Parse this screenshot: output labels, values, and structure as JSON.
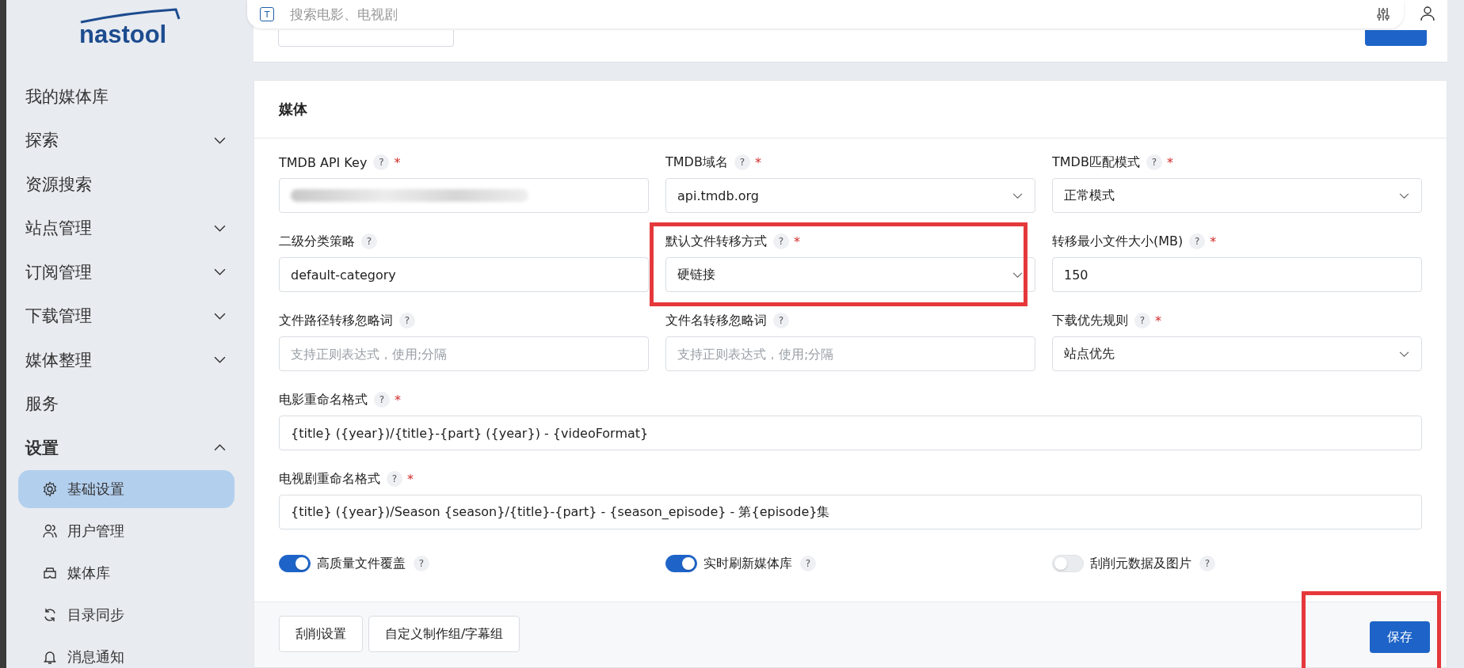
{
  "logo": {
    "text": "nastool"
  },
  "search": {
    "placeholder": "搜索电影、电视剧",
    "prefix": "T"
  },
  "sidebar": {
    "items": [
      {
        "label": "我的媒体库",
        "kind": "link"
      },
      {
        "label": "探索",
        "kind": "group",
        "expanded": false
      },
      {
        "label": "资源搜索",
        "kind": "link"
      },
      {
        "label": "站点管理",
        "kind": "group",
        "expanded": false
      },
      {
        "label": "订阅管理",
        "kind": "group",
        "expanded": false
      },
      {
        "label": "下载管理",
        "kind": "group",
        "expanded": false
      },
      {
        "label": "媒体整理",
        "kind": "group",
        "expanded": false
      },
      {
        "label": "服务",
        "kind": "link"
      },
      {
        "label": "设置",
        "kind": "group",
        "expanded": true,
        "children": [
          {
            "label": "基础设置",
            "selected": true
          },
          {
            "label": "用户管理",
            "selected": false
          },
          {
            "label": "媒体库",
            "selected": false
          },
          {
            "label": "目录同步",
            "selected": false
          },
          {
            "label": "消息通知",
            "selected": false
          }
        ]
      }
    ]
  },
  "section": {
    "title": "媒体",
    "rows": [
      [
        {
          "label": "TMDB API Key",
          "help": "?",
          "required_mark": "*",
          "kind": "redacted",
          "highlighted": false
        },
        {
          "label": "TMDB域名",
          "help": "?",
          "required_mark": "*",
          "kind": "select",
          "value": "api.tmdb.org",
          "highlighted": false
        },
        {
          "label": "TMDB匹配模式",
          "help": "?",
          "required_mark": "*",
          "kind": "select",
          "value": "正常模式",
          "highlighted": false
        }
      ],
      [
        {
          "label": "二级分类策略",
          "help": "?",
          "kind": "input",
          "value": "default-category",
          "highlighted": false
        },
        {
          "label": "默认文件转移方式",
          "help": "?",
          "required_mark": "*",
          "kind": "select",
          "value": "硬链接",
          "highlighted": true
        },
        {
          "label": "转移最小文件大小(MB)",
          "help": "?",
          "required_mark": "*",
          "kind": "input",
          "value": "150",
          "highlighted": false
        }
      ],
      [
        {
          "label": "文件路径转移忽略词",
          "help": "?",
          "kind": "input",
          "placeholder": "支持正则表达式，使用;分隔",
          "highlighted": false
        },
        {
          "label": "文件名转移忽略词",
          "help": "?",
          "kind": "input",
          "placeholder": "支持正则表达式，使用;分隔",
          "highlighted": false
        },
        {
          "label": "下载优先规则",
          "help": "?",
          "required_mark": "*",
          "kind": "select",
          "value": "站点优先",
          "highlighted": false
        }
      ],
      [
        {
          "label": "电影重命名格式",
          "help": "?",
          "required_mark": "*",
          "kind": "input",
          "value": "{title} ({year})/{title}-{part} ({year}) - {videoFormat}",
          "highlighted": false
        }
      ],
      [
        {
          "label": "电视剧重命名格式",
          "help": "?",
          "required_mark": "*",
          "kind": "input",
          "value": "{title} ({year})/Season {season}/{title}-{part} - {season_episode} - 第{episode}集",
          "highlighted": false
        }
      ]
    ],
    "toggles": [
      {
        "label": "高质量文件覆盖",
        "help": "?",
        "on": true
      },
      {
        "label": "实时刷新媒体库",
        "help": "?",
        "on": true
      },
      {
        "label": "刮削元数据及图片",
        "help": "?",
        "on": false
      }
    ]
  },
  "footer": {
    "buttons": [
      {
        "label": "刮削设置"
      },
      {
        "label": "自定义制作组/字幕组"
      }
    ],
    "save": {
      "label": "保存",
      "highlighted": true
    }
  }
}
